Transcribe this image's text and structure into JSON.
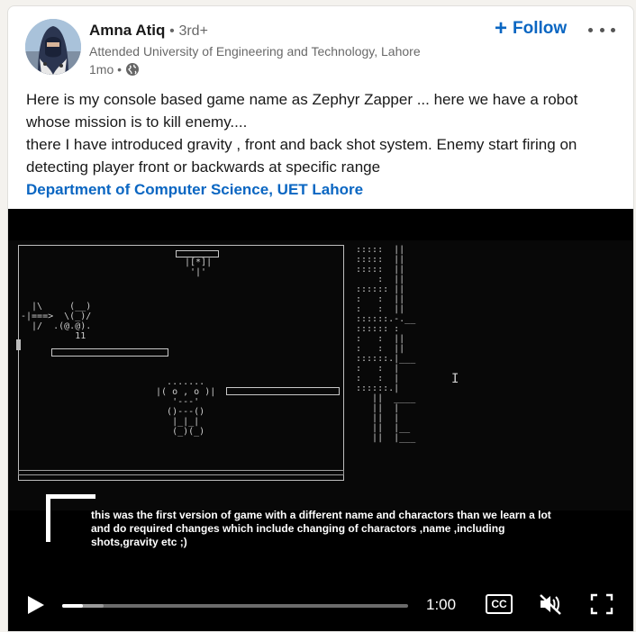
{
  "author": {
    "name": "Amna Atiq",
    "degree": "3rd+",
    "separator": "•",
    "headline": "Attended University of Engineering and Technology, Lahore",
    "time": "1mo •",
    "visibility_icon": "globe-icon"
  },
  "actions": {
    "follow_label": "Follow",
    "follow_icon": "plus-icon",
    "more_icon": "ellipsis-icon"
  },
  "post": {
    "line1": "Here is my console based game name as Zephyr Zapper ... here we have a robot whose mission is to kill enemy....",
    "line2": "there I have introduced gravity , front and back shot system. Enemy start firing on detecting player front or backwards at specific range",
    "hashtag": "Department of Computer Science, UET Lahore"
  },
  "video": {
    "caption": "this was the first version of game with a different name and charactors than we learn a lot and do required changes which include changing of charactors ,name ,including shots,gravity etc ;)",
    "timecode": "1:00",
    "cc_label": "CC",
    "progress_played": 0.06,
    "progress_buffered": 0.12,
    "play_icon": "play-icon",
    "mute_icon": "muted-speaker-icon",
    "fullscreen_icon": "fullscreen-icon"
  },
  "colors": {
    "accent": "#0a66c2",
    "text": "#000000e6",
    "muted": "#00000099",
    "video_bg": "#000000"
  }
}
